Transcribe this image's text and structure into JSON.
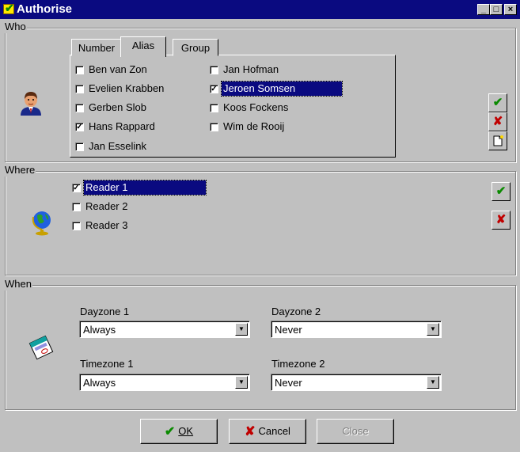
{
  "window": {
    "title": "Authorise",
    "minimize_label": "_",
    "maximize_label": "□",
    "close_label": "×"
  },
  "who": {
    "label": "Who",
    "tabs": [
      "Number",
      "Alias",
      "Group"
    ],
    "active_tab": "Alias",
    "people": [
      {
        "name": "Ben van Zon",
        "checked": false,
        "selected": false
      },
      {
        "name": "Evelien Krabben",
        "checked": false,
        "selected": false
      },
      {
        "name": "Gerben Slob",
        "checked": false,
        "selected": false
      },
      {
        "name": "Hans Rappard",
        "checked": true,
        "selected": false
      },
      {
        "name": "Jan Esselink",
        "checked": false,
        "selected": false
      },
      {
        "name": "Jan Hofman",
        "checked": false,
        "selected": false
      },
      {
        "name": "Jeroen Somsen",
        "checked": true,
        "selected": true
      },
      {
        "name": "Koos Fockens",
        "checked": false,
        "selected": false
      },
      {
        "name": "Wim de Rooij",
        "checked": false,
        "selected": false
      }
    ]
  },
  "where": {
    "label": "Where",
    "readers": [
      {
        "name": "Reader 1",
        "checked": true,
        "selected": true
      },
      {
        "name": "Reader 2",
        "checked": false,
        "selected": false
      },
      {
        "name": "Reader 3",
        "checked": false,
        "selected": false
      }
    ]
  },
  "when": {
    "label": "When",
    "dayzone1": {
      "label": "Dayzone 1",
      "value": "Always"
    },
    "dayzone2": {
      "label": "Dayzone 2",
      "value": "Never"
    },
    "timezone1": {
      "label": "Timezone 1",
      "value": "Always"
    },
    "timezone2": {
      "label": "Timezone 2",
      "value": "Never"
    }
  },
  "buttons": {
    "ok": "OK",
    "cancel": "Cancel",
    "close": "Close"
  },
  "icons": {
    "check": "check-icon",
    "cross": "cross-icon",
    "new": "new-document-icon",
    "person": "person-icon",
    "globe": "globe-icon",
    "calendar": "calendar-icon"
  },
  "colors": {
    "title_bar": "#0a0a80",
    "face": "#c0c0c0",
    "selection": "#0a0a80",
    "check_green": "#0a8a00",
    "cross_red": "#c00000"
  }
}
